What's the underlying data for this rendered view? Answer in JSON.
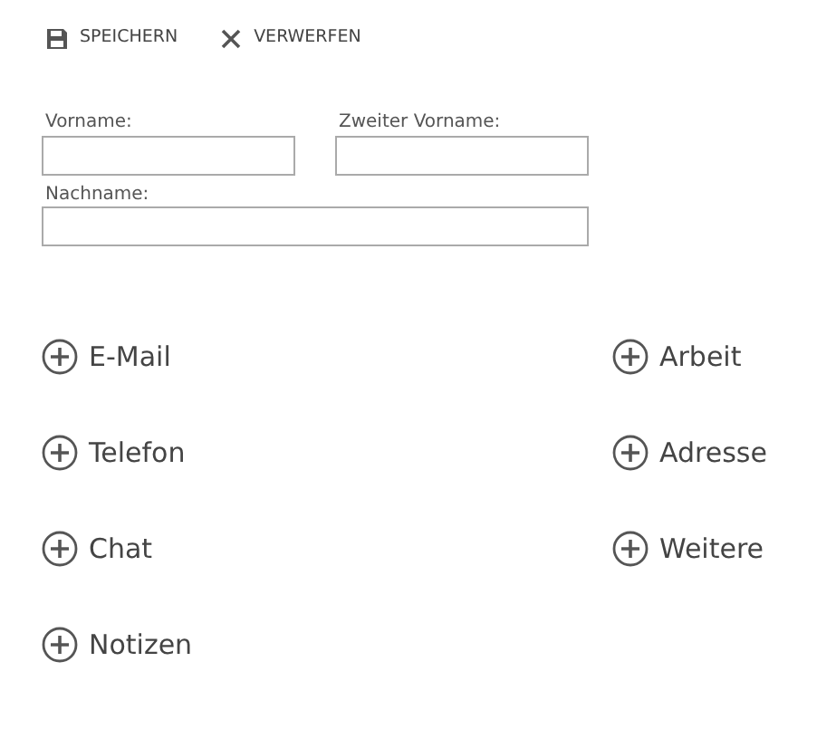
{
  "toolbar": [
    {
      "kind": "save",
      "label": "SPEICHERN"
    },
    {
      "kind": "discard",
      "label": "VERWERFEN"
    }
  ],
  "name_fields": [
    {
      "label": "Vorname:"
    },
    {
      "label": "Zweiter Vorname:"
    }
  ],
  "last_name_field": {
    "label": "Nachname:"
  },
  "add_left": [
    {
      "label": "E-Mail"
    },
    {
      "label": "Telefon"
    },
    {
      "label": "Chat"
    },
    {
      "label": "Notizen"
    }
  ],
  "add_right": [
    {
      "label": "Arbeit"
    },
    {
      "label": "Adresse"
    },
    {
      "label": "Weitere"
    }
  ]
}
